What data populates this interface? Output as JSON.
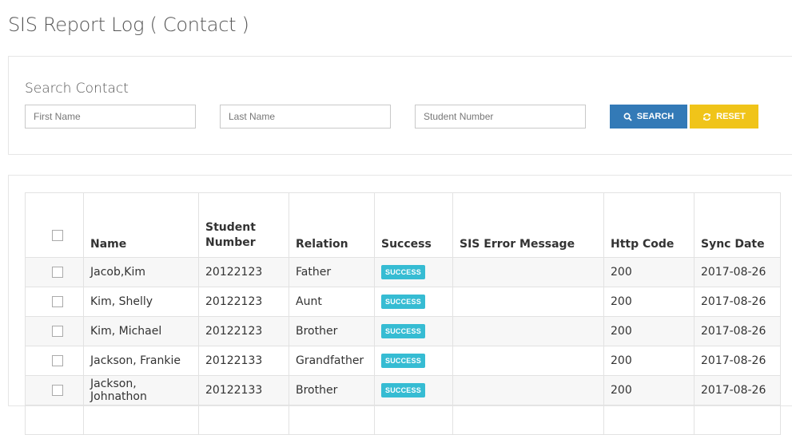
{
  "page": {
    "title": "SIS Report Log ( Contact )"
  },
  "search": {
    "title": "Search Contact",
    "first_name_placeholder": "First Name",
    "last_name_placeholder": "Last Name",
    "student_number_placeholder": "Student Number",
    "search_label": "SEARCH",
    "reset_label": "RESET",
    "search_color": "#337ab7",
    "reset_color": "#f0c419"
  },
  "table": {
    "headers": {
      "name": "Name",
      "student_number": "Student Number",
      "relation": "Relation",
      "success": "Success",
      "sis_error_message": "SIS Error Message",
      "http_code": "Http Code",
      "sync_date": "Sync Date"
    },
    "rows": [
      {
        "name": "Jacob,Kim",
        "student_number": "20122123",
        "relation": "Father",
        "success": "SUCCESS",
        "sis_error_message": "",
        "http_code": "200",
        "sync_date": "2017-08-26"
      },
      {
        "name": "Kim, Shelly",
        "student_number": "20122123",
        "relation": "Aunt",
        "success": "SUCCESS",
        "sis_error_message": "",
        "http_code": "200",
        "sync_date": "2017-08-26"
      },
      {
        "name": "Kim, Michael",
        "student_number": "20122123",
        "relation": "Brother",
        "success": "SUCCESS",
        "sis_error_message": "",
        "http_code": "200",
        "sync_date": "2017-08-26"
      },
      {
        "name": "Jackson, Frankie",
        "student_number": "20122133",
        "relation": "Grandfather",
        "success": "SUCCESS",
        "sis_error_message": "",
        "http_code": "200",
        "sync_date": "2017-08-26"
      },
      {
        "name": "Jackson, Johnathon",
        "student_number": "20122133",
        "relation": "Brother",
        "success": "SUCCESS",
        "sis_error_message": "",
        "http_code": "200",
        "sync_date": "2017-08-26"
      }
    ],
    "badge_color": "#36bcd3"
  }
}
